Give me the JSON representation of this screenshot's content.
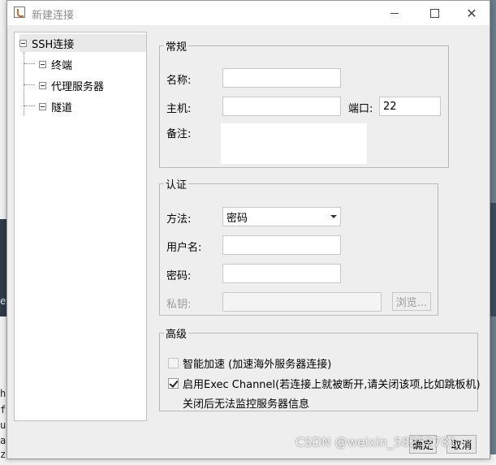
{
  "window": {
    "title": "新建连接"
  },
  "tree": {
    "root": "SSH连接",
    "children": [
      "终端",
      "代理服务器",
      "隧道"
    ]
  },
  "general": {
    "legend": "常规",
    "name_label": "名称:",
    "name_value": "",
    "host_label": "主机:",
    "host_value": "",
    "port_label": "端口:",
    "port_value": "22",
    "note_label": "备注:",
    "note_value": ""
  },
  "auth": {
    "legend": "认证",
    "method_label": "方法:",
    "method_value": "密码",
    "username_label": "用户名:",
    "username_value": "",
    "password_label": "密码:",
    "password_value": "",
    "key_label": "私钥:",
    "key_value": "",
    "browse_label": "浏览..."
  },
  "advanced": {
    "legend": "高级",
    "smart_accel": {
      "label": "智能加速 (加速海外服务器连接)",
      "checked": false,
      "enabled": false
    },
    "exec_channel": {
      "label": "启用Exec Channel(若连接上就被断开,请关闭该项,比如跳板机)",
      "checked": true,
      "enabled": true
    },
    "exec_note": "关闭后无法监控服务器信息"
  },
  "buttons": {
    "ok": "确定",
    "cancel": "取消"
  },
  "background": {
    "left_text": [
      "h",
      "fi",
      "us",
      "al",
      "zi"
    ],
    "dark_text": "e鈕"
  },
  "watermark": "CSDN @weixin_58252781"
}
